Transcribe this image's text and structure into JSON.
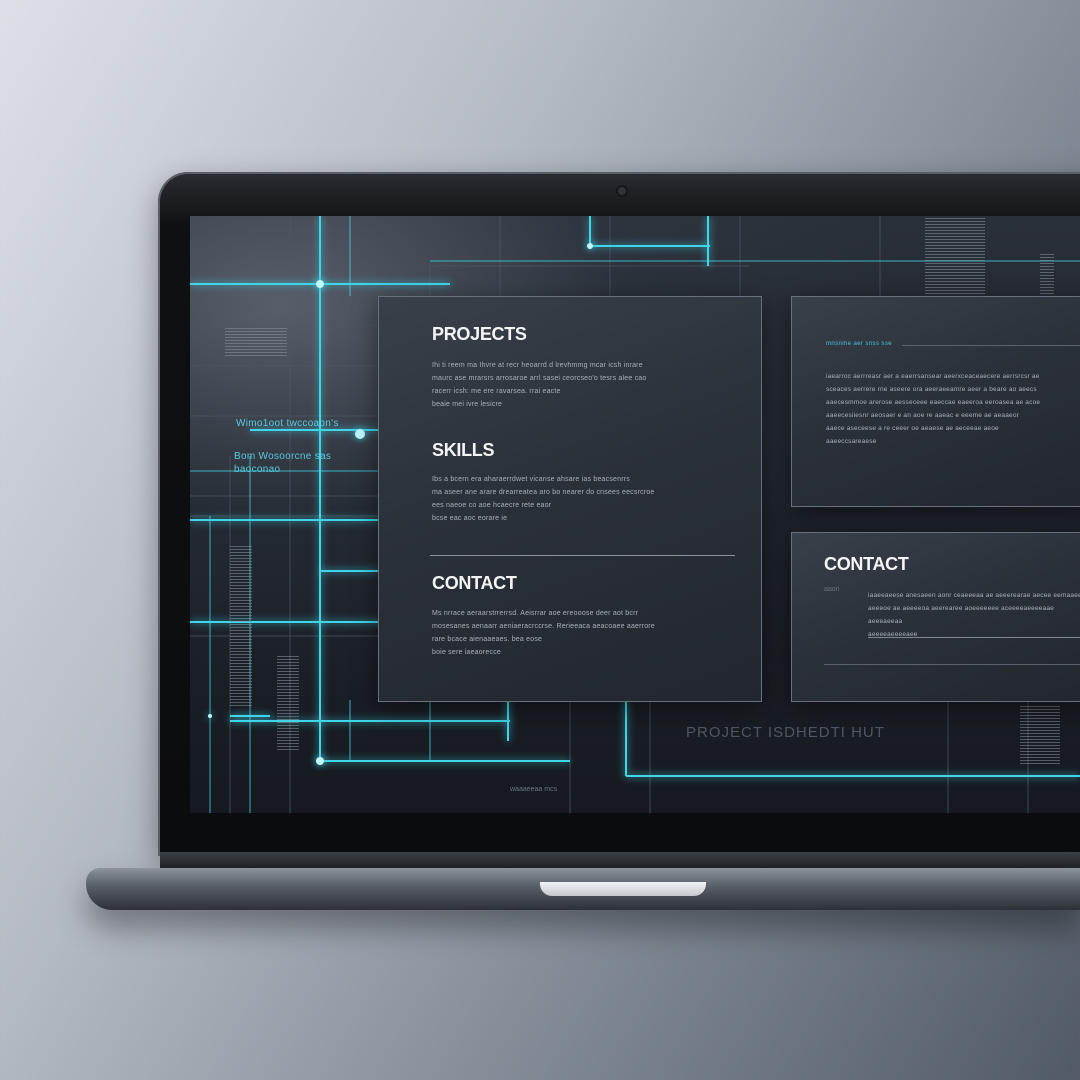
{
  "sections": {
    "projects": {
      "title": "PROJECTS",
      "lines": [
        "Ihi ti reem ma Ihvre at recr heoarrd d lrevhmmg mcar icsh inrare",
        "maurc ase mrarsrs arrosaroe arrl sasei ceorcseo'o tesrs alee cao",
        "racerr icsh: me ere ravarsea. rrai eacte",
        "beaie mei ivre lesicre"
      ]
    },
    "skills": {
      "title": "SKILLS",
      "lines": [
        "Ibs a bcern era aharaerrdwet vicanse ahsare ias beacsenrrs",
        "ma aseer ane arare drearreatea aro bo nearer do cnsees eecsrcroe",
        "ees naeoe co aoe hcaecre rete eaor",
        "bcse eac aoc eorare ie"
      ]
    },
    "contact": {
      "title": "CONTACT",
      "lines": [
        "Ms nrrace aeraarstrrerrsd. Aeisrrar aoe ereooose deer aot bcrr",
        "mosesanes aenaarr aeniaeracrccrse. Rerieeaca aeacoaee aaerrore",
        "rare bcace aienaaeaes. bea eose",
        "boie sere iaeaorecce"
      ]
    }
  },
  "side_top": {
    "heading": "mnsnme aer  snss sse",
    "lines": [
      "iaearroc aerrreasr aer a eaerrsansear aeerxceaceaecere aerrsrcsr ae",
      "sceaces aerrere rne aseere ora aeeraeeamre aeer a beare ao aeecs",
      "aaecesmmoe arerose aesseceee eaeccae eaeeroa eeroasea ae acoe",
      "aaeecesiiesnr aeosaer e an aoe re aaeac e eeeme ae aeaaeor",
      "aaece aseceese a re ceeer oe aeaese ae aeceeae aeoe",
      "aaeeccsareaese"
    ]
  },
  "side_bottom": {
    "title": "CONTACT",
    "small_label": "aaon",
    "lines": [
      "iaaeeaeese anesaeen aonr ceaeeeaa ae aeeerearae aecee eemaaee",
      "aeeeoe ae aeeeeoa aeerearee aoeeeeeee aceeeeaeeeeaae aeeeaeeaa",
      "aeeeeaeeeeaee"
    ]
  },
  "background_captions": {
    "left_1": "Wimo1oot twccoaon's",
    "left_2": "Bom Wosoorcne sas",
    "left_3": "baoconao",
    "footer": "PROJECT ISDHEDTI HUT",
    "bottom_small": "waaaeeaa mcs"
  },
  "colors": {
    "accent": "#3fd6ea",
    "panel": "#2b3139",
    "title_text": "#f3f5f7"
  }
}
